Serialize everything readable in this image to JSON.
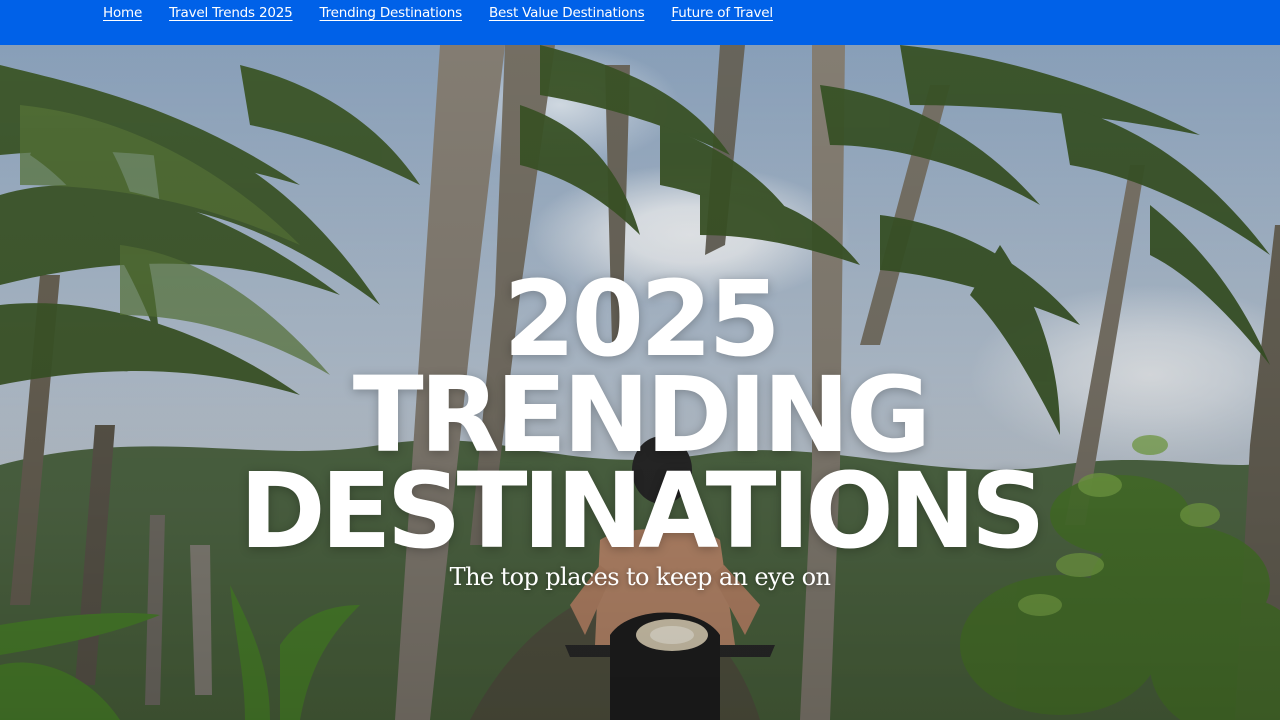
{
  "nav": {
    "items": [
      {
        "label": "Home"
      },
      {
        "label": "Travel Trends 2025"
      },
      {
        "label": "Trending Destinations"
      },
      {
        "label": "Best Value Destinations"
      },
      {
        "label": "Future of Travel"
      }
    ]
  },
  "hero": {
    "line1": "2025",
    "line2": "TRENDING",
    "line3": "DESTINATIONS",
    "subtitle": "The top places to keep an eye on"
  },
  "colors": {
    "nav_bg": "#0061e8",
    "headline": "#ffffff"
  }
}
